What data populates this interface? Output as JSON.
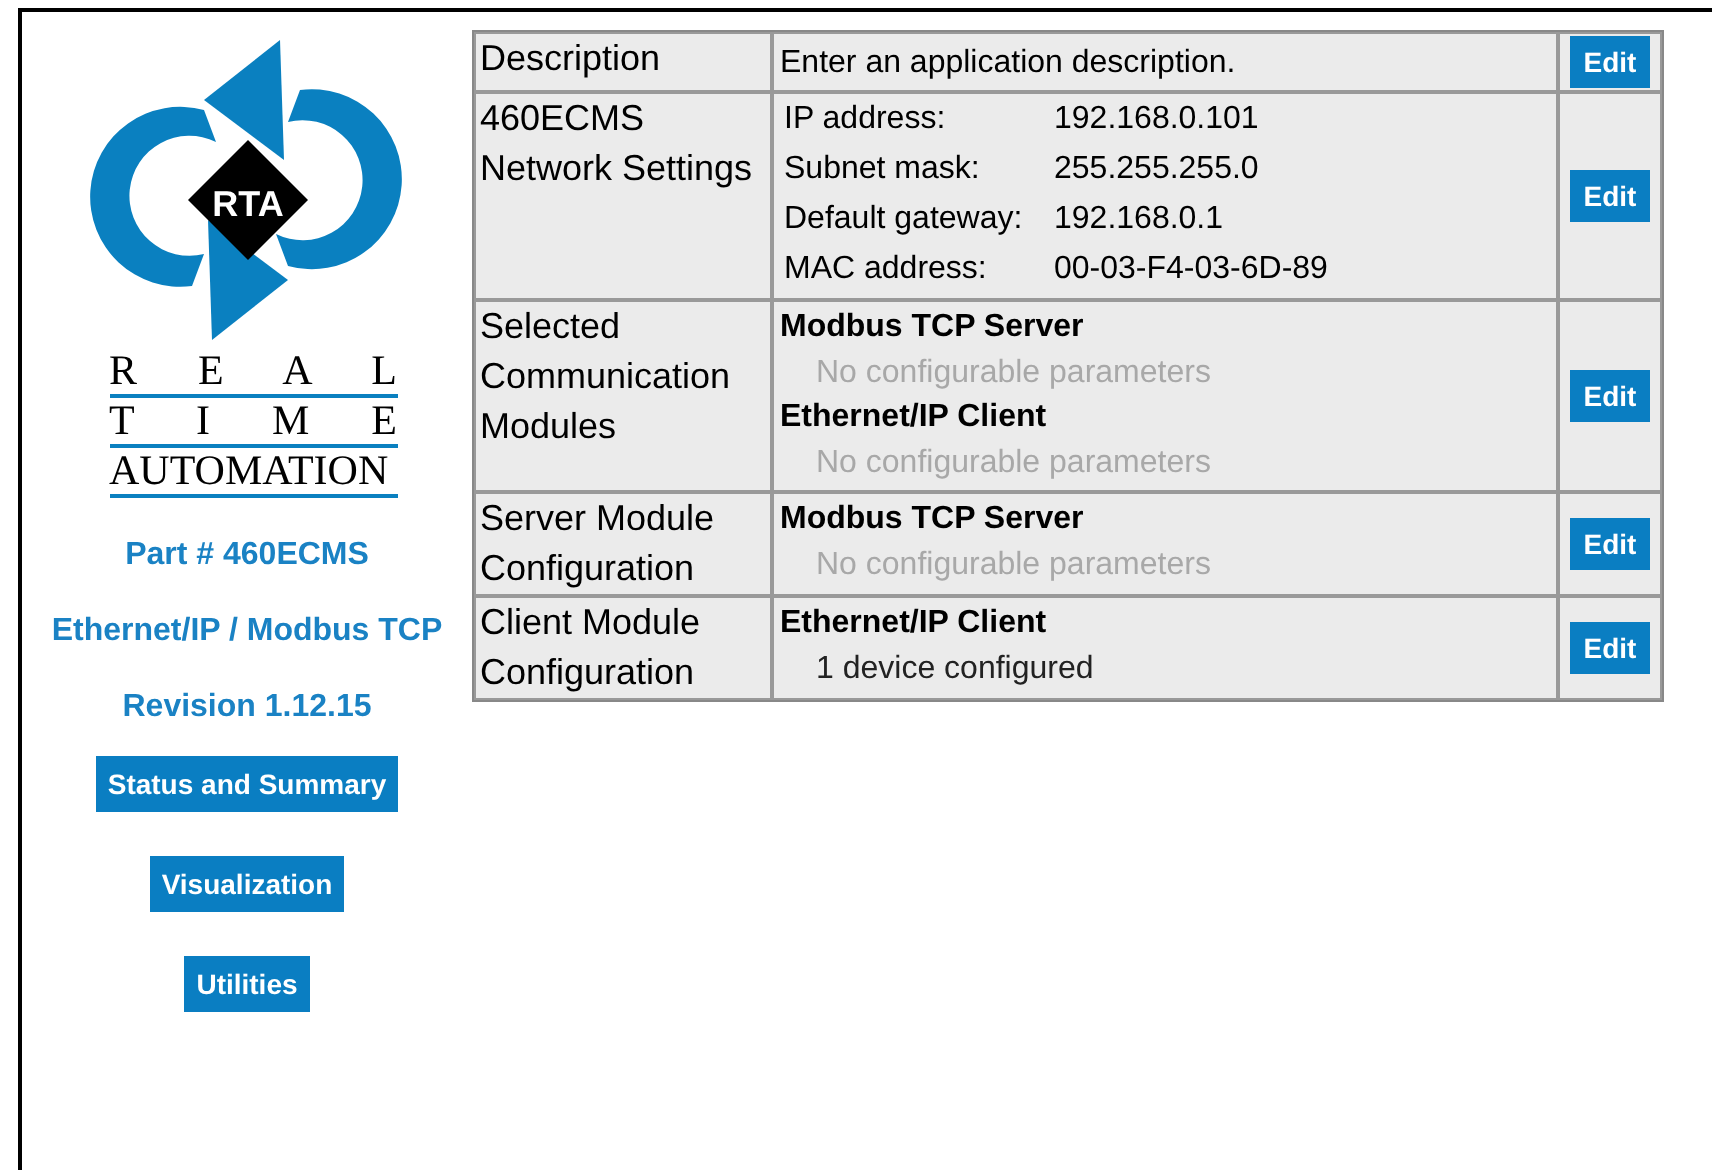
{
  "logo": {
    "mark": "RTA",
    "lines": [
      "R E A L",
      "T I M E",
      "AUTOMATION"
    ]
  },
  "sidebar": {
    "info": [
      "Part # 460ECMS",
      "Ethernet/IP / Modbus TCP",
      "Revision 1.12.15"
    ],
    "buttons": [
      "Status and Summary",
      "Visualization",
      "Utilities"
    ]
  },
  "rows": [
    {
      "label": "Description",
      "kind": "text",
      "text": "Enter an application description.",
      "button": "Edit"
    },
    {
      "label": "460ECMS Network Settings",
      "kind": "fields",
      "button": "Edit",
      "fields": [
        {
          "name": "IP address:",
          "value": "192.168.0.101"
        },
        {
          "name": "Subnet mask:",
          "value": "255.255.255.0"
        },
        {
          "name": "Default gateway:",
          "value": "192.168.0.1"
        },
        {
          "name": "MAC address:",
          "value": "00-03-F4-03-6D-89"
        }
      ]
    },
    {
      "label": "Selected Communication Modules",
      "kind": "modules",
      "button": "Edit",
      "modules": [
        {
          "name": "Modbus TCP Server",
          "detail": "No configurable parameters",
          "disabled": true
        },
        {
          "name": "Ethernet/IP Client",
          "detail": "No configurable parameters",
          "disabled": true
        }
      ]
    },
    {
      "label": "Server Module Configuration",
      "kind": "modules",
      "button": "Edit",
      "modules": [
        {
          "name": "Modbus TCP Server",
          "detail": "No configurable parameters",
          "disabled": true
        }
      ]
    },
    {
      "label": "Client Module Configuration",
      "kind": "modules",
      "button": "Edit",
      "modules": [
        {
          "name": "Ethernet/IP Client",
          "detail": "1 device configured",
          "disabled": false
        }
      ]
    }
  ]
}
